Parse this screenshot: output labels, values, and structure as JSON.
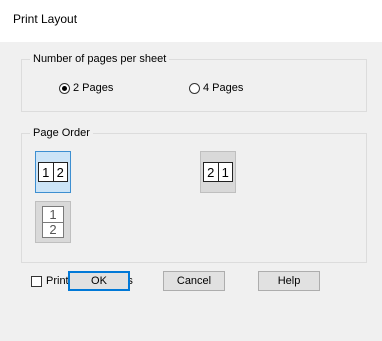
{
  "window": {
    "title": "Print Layout"
  },
  "pages_group": {
    "legend": "Number of pages per sheet",
    "options": [
      {
        "label": "2 Pages",
        "checked": true
      },
      {
        "label": "4 Pages",
        "checked": false
      }
    ]
  },
  "order_group": {
    "legend": "Page Order",
    "left_to_right": {
      "first": "1",
      "second": "2",
      "selected": true
    },
    "right_to_left": {
      "first": "2",
      "second": "1",
      "selected": false
    },
    "top_to_bottom": {
      "first": "1",
      "second": "2",
      "selected": false
    }
  },
  "print_frames": {
    "label": "Print page frames",
    "checked": false
  },
  "buttons": {
    "ok": "OK",
    "cancel": "Cancel",
    "help": "Help"
  },
  "colors": {
    "selection_bg": "#cce4f7",
    "selection_border": "#3d8fd1",
    "default_button_border": "#0078d7"
  }
}
